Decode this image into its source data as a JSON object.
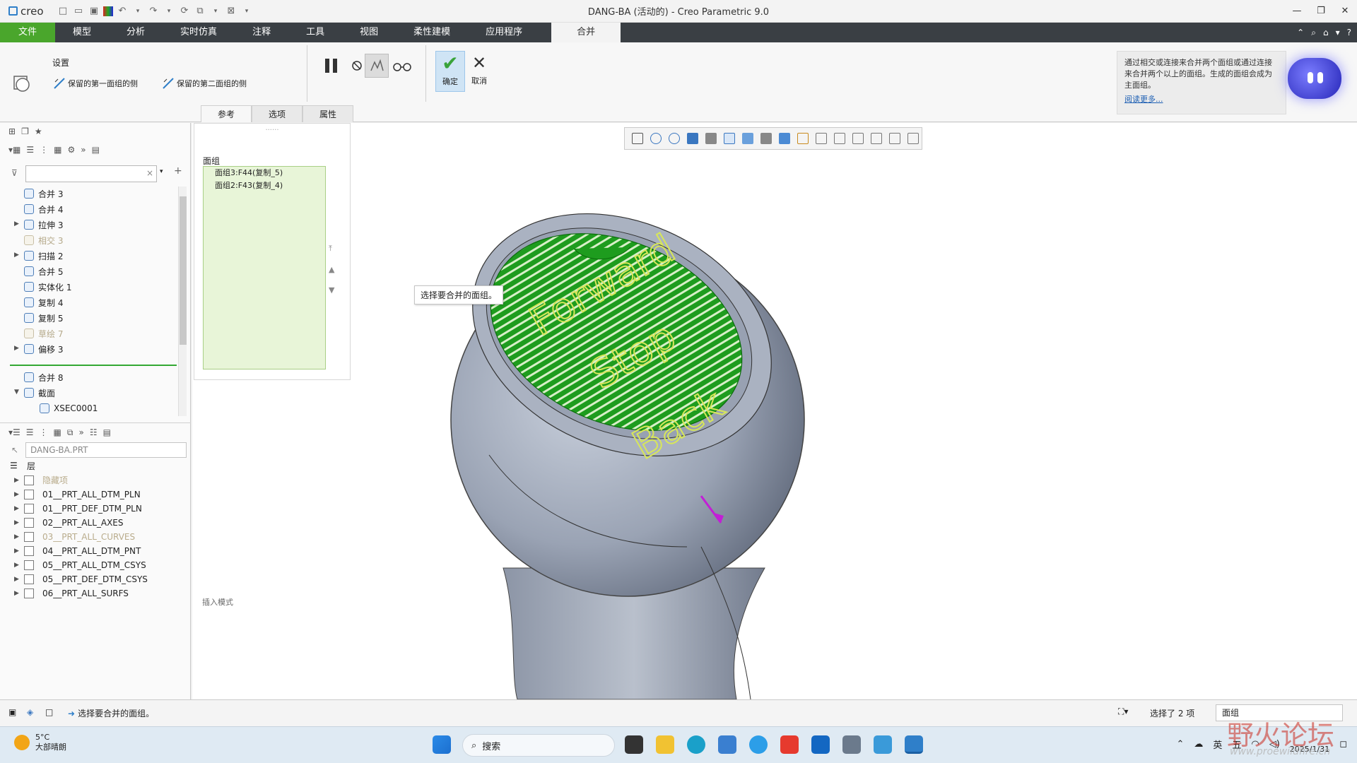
{
  "app": {
    "logo_text": "creo",
    "window_title": "DANG-BA (活动的) - Creo Parametric 9.0"
  },
  "tabs": [
    "文件",
    "模型",
    "分析",
    "实时仿真",
    "注释",
    "工具",
    "视图",
    "柔性建模",
    "应用程序",
    "合并"
  ],
  "active_tab": "合并",
  "ribbon": {
    "settings_label": "设置",
    "keep_first_side": "保留的第一面组的侧",
    "keep_second_side": "保留的第二面组的侧",
    "ok_label": "确定",
    "cancel_label": "取消",
    "subtabs": [
      "参考",
      "选项",
      "属性"
    ],
    "help_text": "通过相交或连接来合并两个面组或通过连接来合并两个以上的面组。生成的面组会成为主面组。",
    "help_link": "阅读更多..."
  },
  "model_tree": {
    "items": [
      {
        "label": "合并 3",
        "dim": false,
        "expandable": false
      },
      {
        "label": "合并 4",
        "dim": false,
        "expandable": false
      },
      {
        "label": "拉伸 3",
        "dim": false,
        "expandable": true
      },
      {
        "label": "相交 3",
        "dim": true,
        "expandable": false
      },
      {
        "label": "扫描 2",
        "dim": false,
        "expandable": true
      },
      {
        "label": "合并 5",
        "dim": false,
        "expandable": false
      },
      {
        "label": "实体化 1",
        "dim": false,
        "expandable": false
      },
      {
        "label": "复制 4",
        "dim": false,
        "expandable": false
      },
      {
        "label": "复制 5",
        "dim": false,
        "expandable": false
      },
      {
        "label": "草绘 7",
        "dim": true,
        "expandable": false
      },
      {
        "label": "偏移 3",
        "dim": false,
        "expandable": true
      }
    ],
    "new_feature": "合并 8",
    "section_label": "截面",
    "section_child": "XSEC0001"
  },
  "layer_tree": {
    "part_combo": "DANG-BA.PRT",
    "root_label": "层",
    "items": [
      {
        "label": "隐藏项",
        "dim": true
      },
      {
        "label": "01__PRT_ALL_DTM_PLN",
        "dim": false
      },
      {
        "label": "01__PRT_DEF_DTM_PLN",
        "dim": false
      },
      {
        "label": "02__PRT_ALL_AXES",
        "dim": false
      },
      {
        "label": "03__PRT_ALL_CURVES",
        "dim": true
      },
      {
        "label": "04__PRT_ALL_DTM_PNT",
        "dim": false
      },
      {
        "label": "05__PRT_ALL_DTM_CSYS",
        "dim": false
      },
      {
        "label": "05__PRT_DEF_DTM_CSYS",
        "dim": false
      },
      {
        "label": "06__PRT_ALL_SURFS",
        "dim": false
      }
    ]
  },
  "references": {
    "label": "面组",
    "items": [
      "面组3:F44(复制_5)",
      "面组2:F43(复制_4)"
    ],
    "insert_mode": "插入模式"
  },
  "viewport": {
    "tooltip": "选择要合并的面组。",
    "model_text": [
      "Forward",
      "Stop",
      "Back"
    ]
  },
  "status": {
    "message": "选择要合并的面组。",
    "selection_count": "选择了 2 项",
    "filter": "面组"
  },
  "taskbar": {
    "temperature": "5°C",
    "weather": "大部晴朗",
    "search_placeholder": "搜索",
    "ime_lang": "英",
    "ime_mode": "五",
    "date": "2025/1/31",
    "watermark": "野火论坛",
    "watermark_url": "www.proewildfire.cn"
  },
  "colors": {
    "file_tab": "#4aa62c",
    "tab_bar": "#3a3f44",
    "surface_green": "#1f9e1f",
    "model_grey": "#8a94a6"
  }
}
